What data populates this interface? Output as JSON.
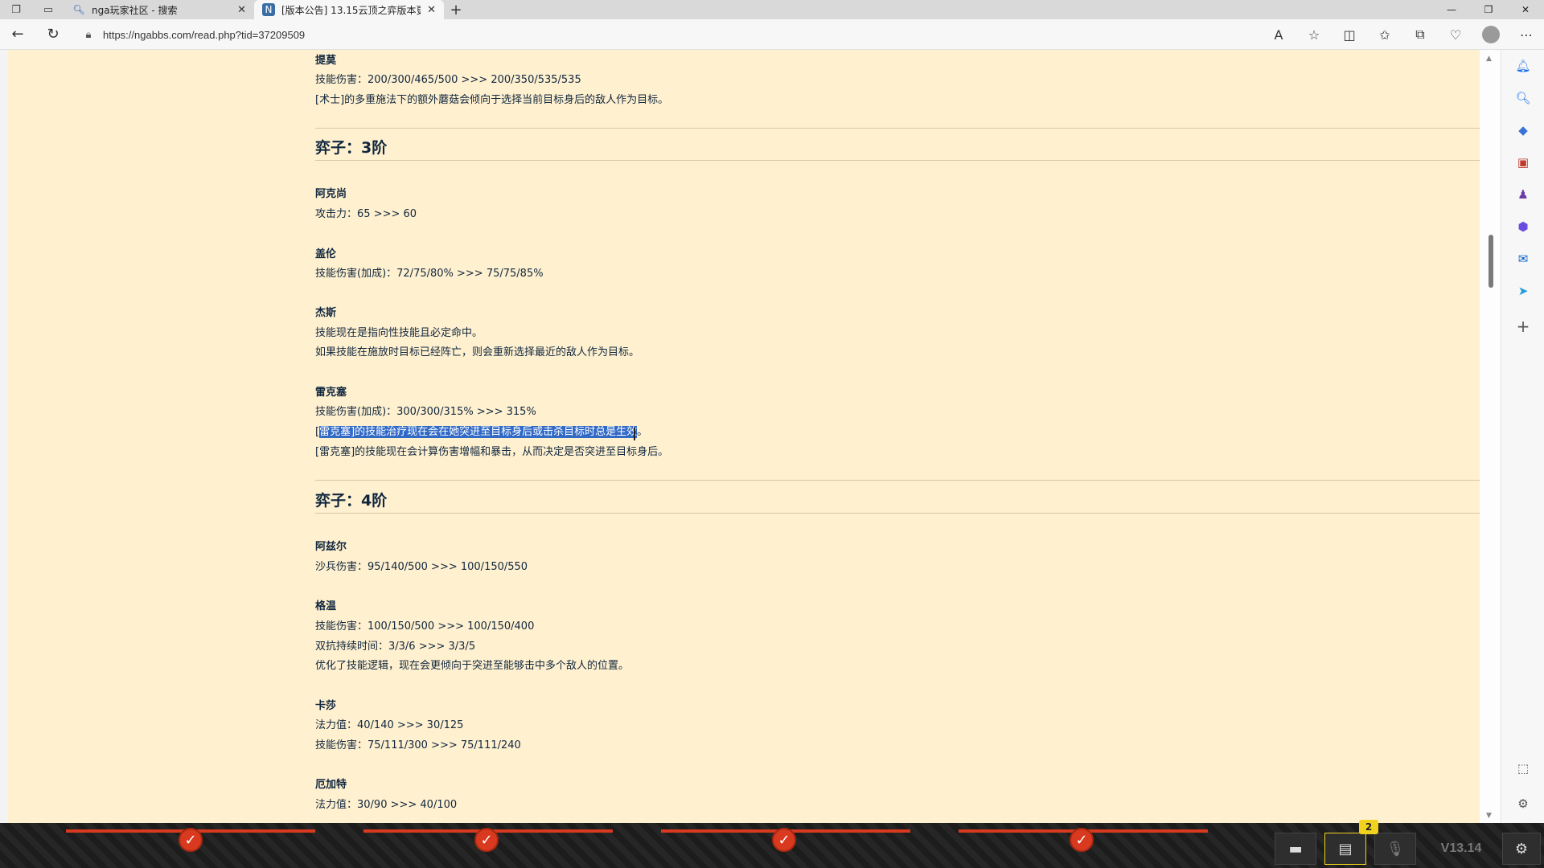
{
  "browser": {
    "tabs": [
      {
        "title": "nga玩家社区 - 搜索",
        "icon": "search-icon"
      },
      {
        "title": "[版本公告] 13.15云顶之弈版本更",
        "icon": "nga-favicon"
      }
    ],
    "url": "https://ngabbs.com/read.php?tid=37209509"
  },
  "content": {
    "top_hero": {
      "name": "提莫",
      "lines": [
        "技能伤害：200/300/465/500 >>> 200/350/535/535",
        "[术士]的多重施法下的额外蘑菇会倾向于选择当前目标身后的敌人作为目标。"
      ]
    },
    "tier3": {
      "title": "弈子：3阶",
      "heroes": [
        {
          "name": "阿克尚",
          "lines": [
            "攻击力：65 >>> 60"
          ]
        },
        {
          "name": "盖伦",
          "lines": [
            "技能伤害(加成)：72/75/80% >>> 75/75/85%"
          ]
        },
        {
          "name": "杰斯",
          "lines": [
            "技能现在是指向性技能且必定命中。",
            "如果技能在施放时目标已经阵亡，则会重新选择最近的敌人作为目标。"
          ]
        },
        {
          "name": "雷克塞",
          "lines": [
            "技能伤害(加成)：300/300/315% >>> 315%"
          ]
        }
      ],
      "rek_selected_prefix": "[",
      "rek_selected": "雷克塞]的技能治疗现在会在她突进至目标身后或击杀目标时总是生效",
      "rek_selected_suffix": "。",
      "rek_line3": "[雷克塞]的技能现在会计算伤害增幅和暴击，从而决定是否突进至目标身后。"
    },
    "tier4": {
      "title": "弈子：4阶",
      "heroes": [
        {
          "name": "阿兹尔",
          "lines": [
            "沙兵伤害：95/140/500 >>> 100/150/550"
          ]
        },
        {
          "name": "格温",
          "lines": [
            "技能伤害：100/150/500 >>> 100/150/400",
            "双抗持续时间：3/3/6 >>> 3/3/5",
            "优化了技能逻辑，现在会更倾向于突进至能够击中多个敌人的位置。"
          ]
        },
        {
          "name": "卡莎",
          "lines": [
            "法力值：40/140 >>> 30/125",
            "技能伤害：75/111/300 >>> 75/111/240"
          ]
        },
        {
          "name": "厄加特",
          "lines": [
            "法力值：30/90 >>> 40/100"
          ]
        }
      ]
    }
  },
  "gamebar": {
    "badge": "2",
    "version": "V13.14"
  }
}
